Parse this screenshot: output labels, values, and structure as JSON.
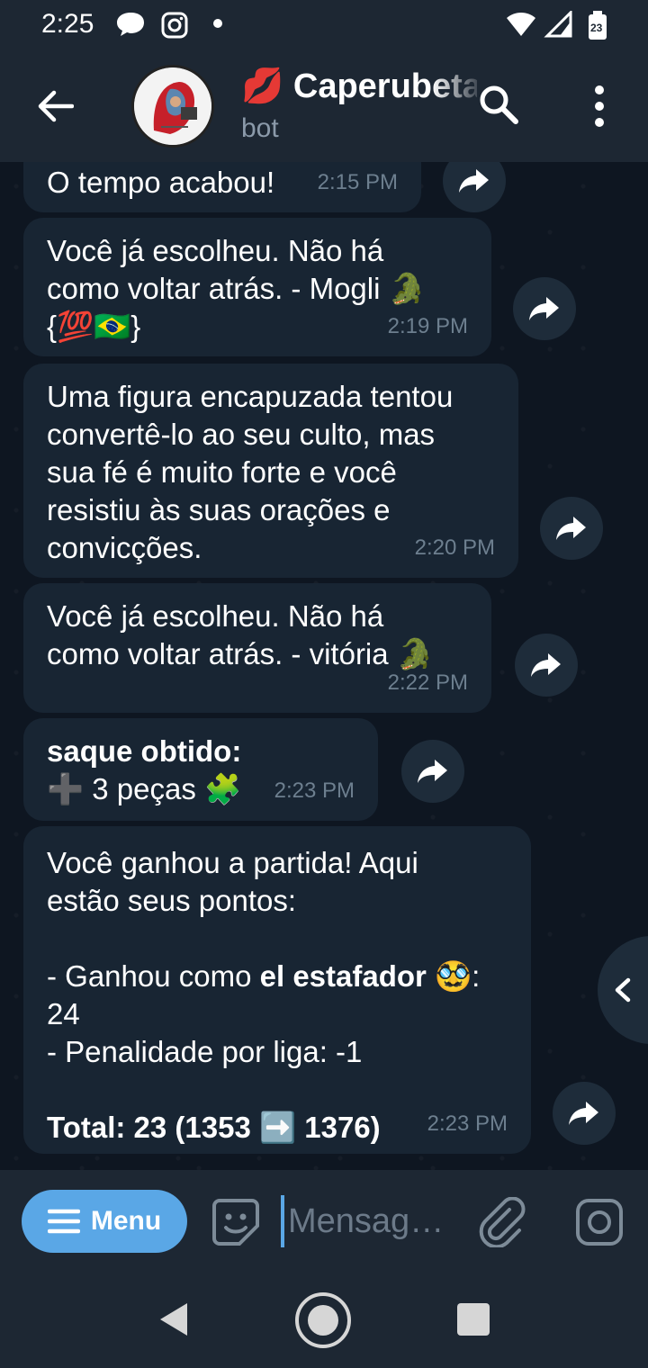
{
  "status_bar": {
    "time": "2:25",
    "battery": "23"
  },
  "header": {
    "title": "💋 Caperubeta",
    "subtitle": "bot"
  },
  "messages": [
    {
      "text": "O tempo acabou!",
      "time": "2:15 PM"
    },
    {
      "text": "Você já escolheu. Não há\ncomo voltar atrás. - Mogli 🐊\n{💯🇧🇷}",
      "time": "2:19 PM"
    },
    {
      "text": "Uma figura encapuzada tentou\nconvertê-lo ao seu culto, mas\nsua fé é muito forte e você\nresistiu às suas orações e\nconvicções.",
      "time": "2:20 PM"
    },
    {
      "text": "Você já escolheu. Não há\ncomo voltar atrás. - vitória 🐊",
      "time": "2:22 PM"
    },
    {
      "title": "saque obtido:",
      "text": "➕ 3 peças 🧩",
      "time": "2:23 PM"
    },
    {
      "line1": "Você ganhou a partida! Aqui",
      "line2": "estão seus pontos:",
      "line3a": "- Ganhou como ",
      "line3b": "el estafador 🥸",
      "line3c": ":",
      "line4": "24",
      "line5": "- Penalidade por liga: -1",
      "line6": "Total: 23 (1353 ➡️ 1376)",
      "time": "2:23 PM"
    }
  ],
  "input_bar": {
    "menu_label": "Menu",
    "placeholder": "Mensag…"
  },
  "colors": {
    "accent": "#5aa7e6",
    "bubble": "#182533",
    "background": "#0e1621",
    "header": "#1d2733"
  }
}
